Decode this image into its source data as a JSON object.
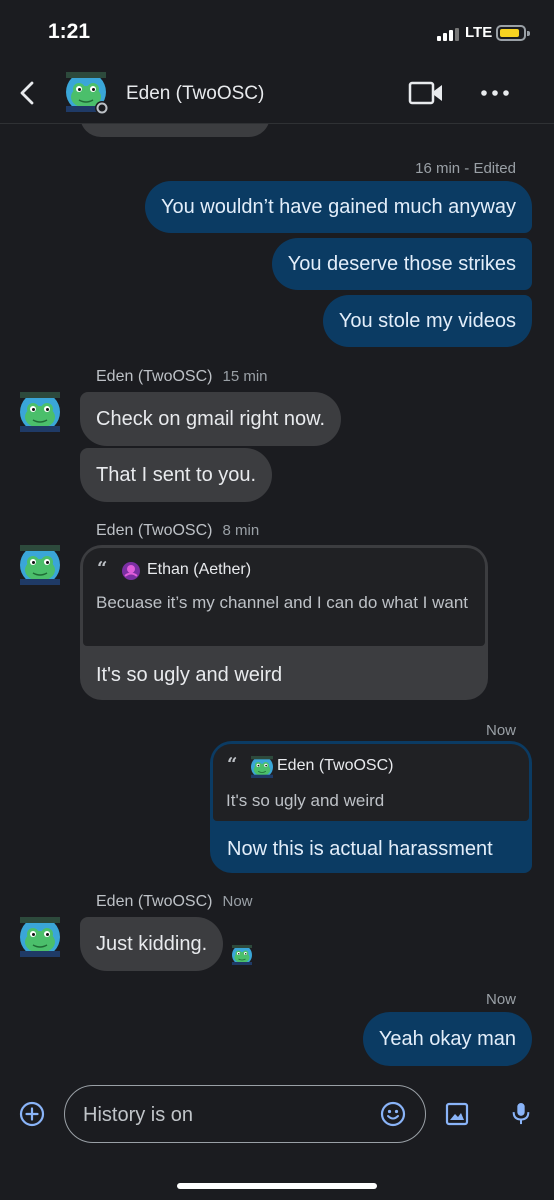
{
  "status": {
    "time": "1:21",
    "network": "LTE"
  },
  "header": {
    "contact_name": "Eden (TwoOSC)"
  },
  "messages": [
    {
      "dir": "out",
      "meta": "16 min - Edited",
      "text": "You wouldn’t have gained much anyway"
    },
    {
      "dir": "out",
      "text": "You deserve those strikes"
    },
    {
      "dir": "out",
      "text": "You stole my videos"
    },
    {
      "dir": "in",
      "sender": "Eden (TwoOSC)",
      "time": "15 min",
      "text": "Check on gmail right now."
    },
    {
      "dir": "in",
      "text": "That I sent to you."
    },
    {
      "dir": "in",
      "sender": "Eden (TwoOSC)",
      "time": "8 min",
      "quote": {
        "name": "Ethan (Aether)",
        "text": "Becuase it’s my channel and I can do what I want"
      },
      "text": "It's so ugly and weird"
    },
    {
      "dir": "out",
      "meta": "Now",
      "quote": {
        "name": "Eden (TwoOSC)",
        "text": "It's so ugly and weird"
      },
      "text": "Now this is actual harassment"
    },
    {
      "dir": "in",
      "sender": "Eden (TwoOSC)",
      "time": "Now",
      "text": "Just kidding."
    },
    {
      "dir": "out",
      "meta": "Now",
      "text": "Yeah okay man"
    }
  ],
  "composer": {
    "placeholder": "History is on"
  },
  "colors": {
    "background": "#1b1c20",
    "outgoing": "#0b3b63",
    "incoming": "#3c3d40",
    "accent": "#8ab4f8"
  }
}
